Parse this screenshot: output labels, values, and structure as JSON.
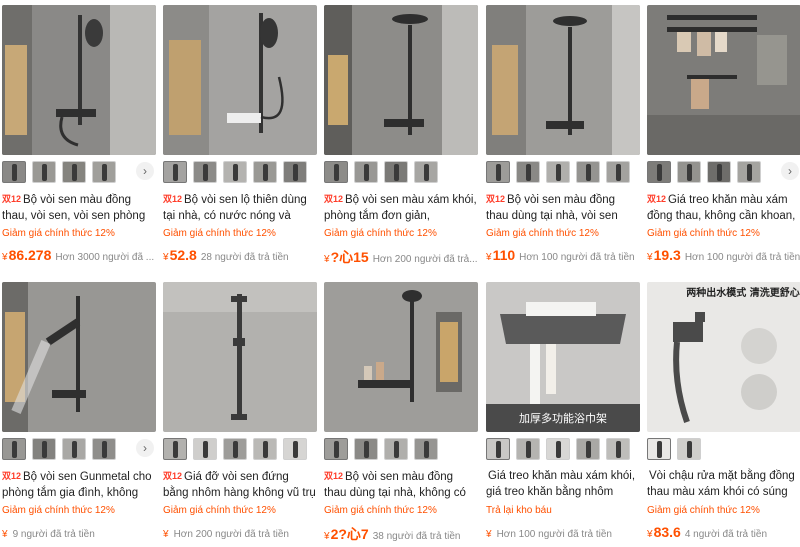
{
  "products": [
    {
      "tag": "双12",
      "title": "Bộ vòi sen màu đồng thau, vòi sen, vòi sen phòng",
      "promo": "Giảm giá chính thức 12%",
      "currency": "¥",
      "price": "86.278",
      "sold": "Hơn 3000 người đã ...",
      "bg": "#8a8987"
    },
    {
      "tag": "双12",
      "title": "Bộ vòi sen lộ thiên dùng tại nhà, có nước nóng và lạnh,",
      "promo": "Giảm giá chính thức 12%",
      "currency": "¥",
      "price": "52.8",
      "sold": "28 người đã trả tiền",
      "bg": "#a4a3a1"
    },
    {
      "tag": "双12",
      "title": "Bộ vòi sen màu xám khói, phòng tắm đơn giản,",
      "promo": "Giảm giá chính thức 12%",
      "currency": "¥",
      "price": "?心15",
      "sold": "Hơn 200 người đã trả...",
      "bg": "#8d8c89"
    },
    {
      "tag": "双12",
      "title": "Bộ vòi sen màu đồng thau dùng tại nhà, vòi sen",
      "promo": "Giảm giá chính thức 12%",
      "currency": "¥",
      "price": "110",
      "sold": "Hơn 100 người đã trả tiền",
      "bg": "#9d9c99"
    },
    {
      "tag": "双12",
      "title": "Giá treo khăn màu xám đồng thau, không cần khoan,",
      "promo": "Giảm giá chính thức 12%",
      "currency": "¥",
      "price": "19.3",
      "sold": "Hơn 100 người đã trả tiền",
      "bg": "#7d7c79"
    },
    {
      "tag": "双12",
      "title": "Bộ vòi sen Gunmetal cho phòng tắm gia đình, không",
      "promo": "Giảm giá chính thức 12%",
      "currency": "¥",
      "price": "",
      "sold": "9 người đã trả tiền",
      "bg": "#989794"
    },
    {
      "tag": "双12",
      "title": "Giá đỡ vòi sen đứng bằng nhôm hàng không vũ trụ",
      "promo": "Giảm giá chính thức 12%",
      "currency": "¥",
      "price": "",
      "sold": "Hơn 200 người đã trả tiền",
      "bg": "#b2b1ae"
    },
    {
      "tag": "双12",
      "title": "Bộ vòi sen màu đồng thau dùng tại nhà, không có",
      "promo": "Giảm giá chính thức 12%",
      "currency": "¥",
      "price": "2?心7",
      "sold": "38 người đã trả tiền",
      "bg": "#9e9d9a"
    },
    {
      "tag": "",
      "title": "Giá treo khăn màu xám khói, giá treo khăn bằng nhôm",
      "promo": "Trả lại kho báu",
      "currency": "¥",
      "price": "",
      "sold": "Hơn 100 người đã trả tiền",
      "bg": "#c9c8c6",
      "caption": "加厚多功能浴巾架"
    },
    {
      "tag": "",
      "title": "Vòi chậu rửa mặt bằng đồng thau màu xám khói có súng",
      "promo": "Giảm giá chính thức 12%",
      "currency": "¥",
      "price": "83.6",
      "sold": "4 người đã trả tiền",
      "bg": "#e9e8e6",
      "caption": "两种出水模式 清洗更舒心"
    }
  ],
  "next_icon": "›"
}
